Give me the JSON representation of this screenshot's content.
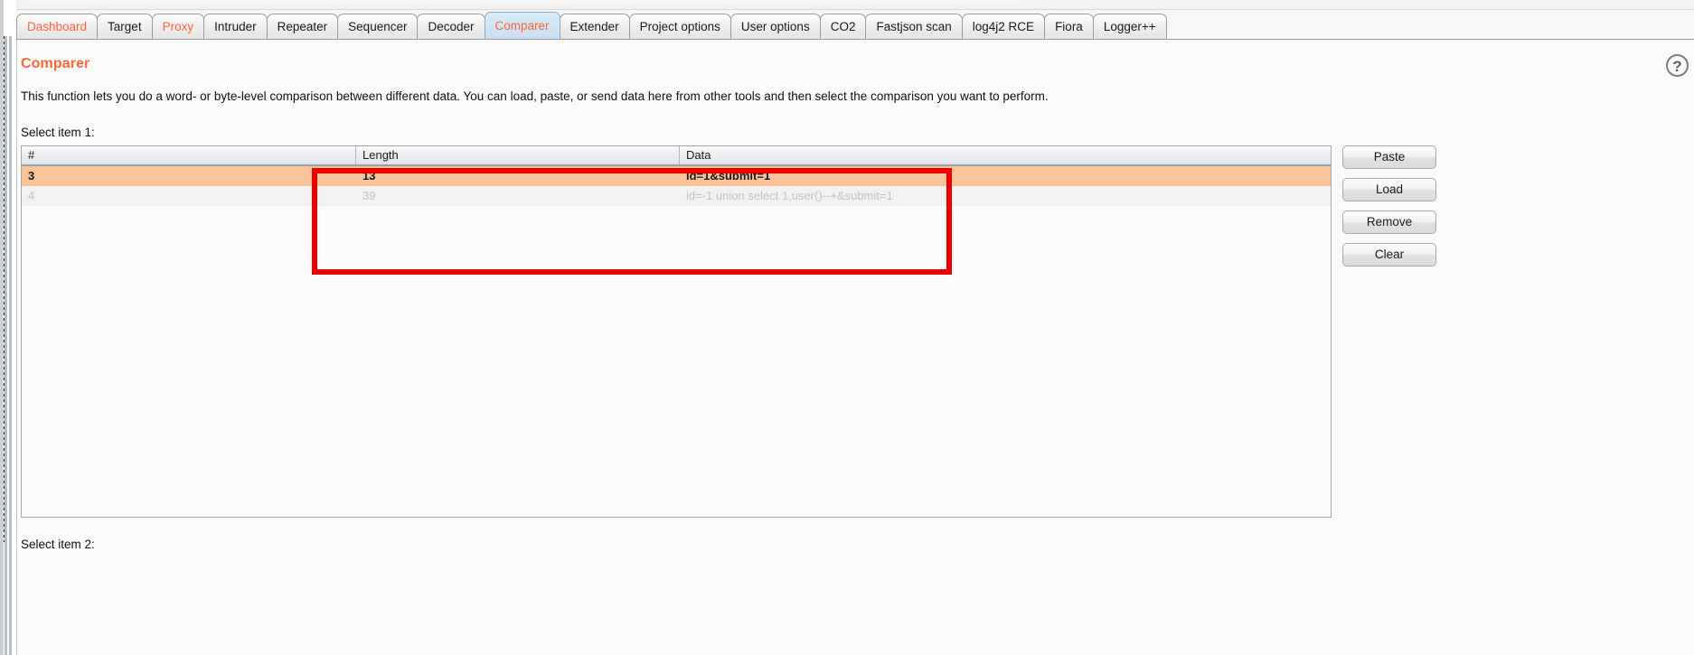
{
  "window": {
    "tabs": [
      {
        "label": "Dashboard",
        "accent": true,
        "active": false
      },
      {
        "label": "Target",
        "accent": false,
        "active": false
      },
      {
        "label": "Proxy",
        "accent": true,
        "active": false
      },
      {
        "label": "Intruder",
        "accent": false,
        "active": false
      },
      {
        "label": "Repeater",
        "accent": false,
        "active": false
      },
      {
        "label": "Sequencer",
        "accent": false,
        "active": false
      },
      {
        "label": "Decoder",
        "accent": false,
        "active": false
      },
      {
        "label": "Comparer",
        "accent": true,
        "active": true
      },
      {
        "label": "Extender",
        "accent": false,
        "active": false
      },
      {
        "label": "Project options",
        "accent": false,
        "active": false
      },
      {
        "label": "User options",
        "accent": false,
        "active": false
      },
      {
        "label": "CO2",
        "accent": false,
        "active": false
      },
      {
        "label": "Fastjson scan",
        "accent": false,
        "active": false
      },
      {
        "label": "log4j2 RCE",
        "accent": false,
        "active": false
      },
      {
        "label": "Fiora",
        "accent": false,
        "active": false
      },
      {
        "label": "Logger++",
        "accent": false,
        "active": false
      }
    ]
  },
  "page": {
    "title": "Comparer",
    "help_glyph": "?",
    "description": "This function lets you do a word- or byte-level comparison between different data. You can load, paste, or send data here from other tools and then select the comparison you want to perform.",
    "select_item_1_label": "Select item 1:",
    "select_item_2_label": "Select item 2:"
  },
  "table": {
    "columns": [
      "#",
      "Length",
      "Data"
    ],
    "rows": [
      {
        "num": "3",
        "length": "13",
        "data": "id=1&submit=1",
        "state": "selected"
      },
      {
        "num": "4",
        "length": "39",
        "data": "id=-1 union select 1,user()--+&submit=1",
        "state": "dim"
      }
    ]
  },
  "buttons": [
    {
      "label": "Paste"
    },
    {
      "label": "Load"
    },
    {
      "label": "Remove"
    },
    {
      "label": "Clear"
    }
  ],
  "colors": {
    "accent": "#ff6633",
    "selected_row": "#fac39a",
    "annotation": "#ee0000",
    "active_tab": "#cfe3f4"
  }
}
